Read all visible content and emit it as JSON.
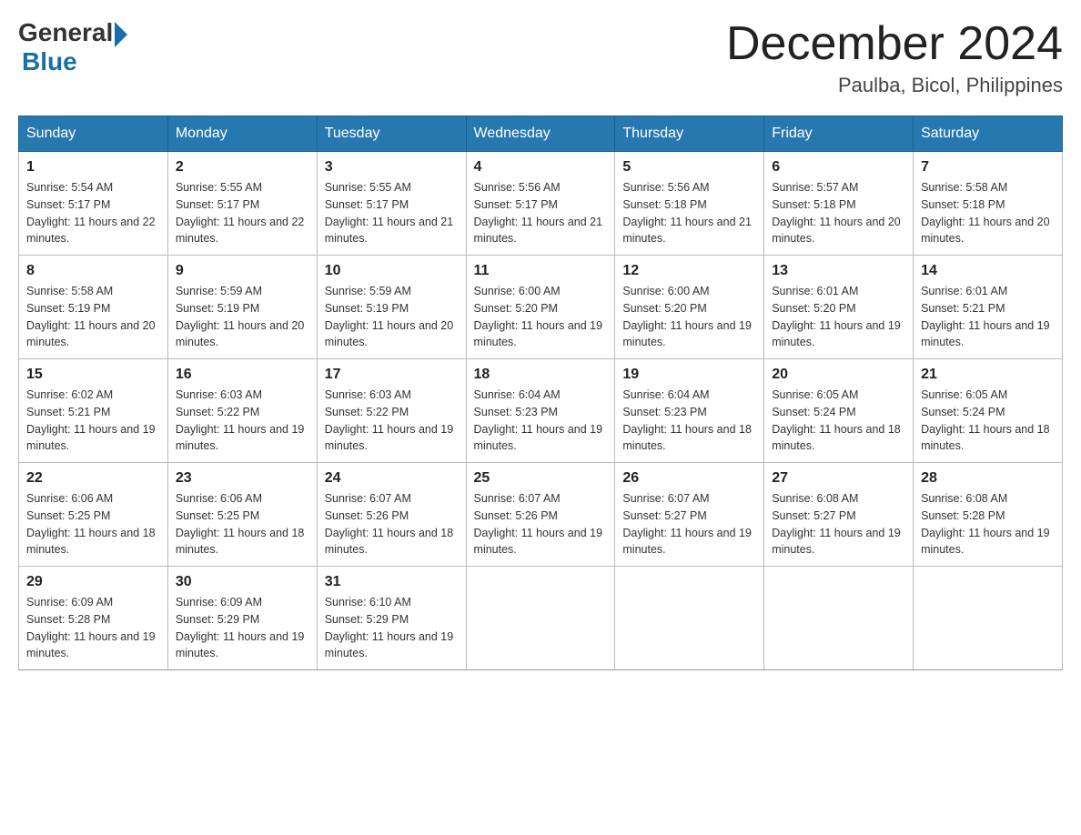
{
  "header": {
    "logo_general": "General",
    "logo_blue": "Blue",
    "month_year": "December 2024",
    "location": "Paulba, Bicol, Philippines"
  },
  "days_of_week": [
    "Sunday",
    "Monday",
    "Tuesday",
    "Wednesday",
    "Thursday",
    "Friday",
    "Saturday"
  ],
  "weeks": [
    [
      {
        "day": "1",
        "sunrise": "5:54 AM",
        "sunset": "5:17 PM",
        "daylight": "11 hours and 22 minutes."
      },
      {
        "day": "2",
        "sunrise": "5:55 AM",
        "sunset": "5:17 PM",
        "daylight": "11 hours and 22 minutes."
      },
      {
        "day": "3",
        "sunrise": "5:55 AM",
        "sunset": "5:17 PM",
        "daylight": "11 hours and 21 minutes."
      },
      {
        "day": "4",
        "sunrise": "5:56 AM",
        "sunset": "5:17 PM",
        "daylight": "11 hours and 21 minutes."
      },
      {
        "day": "5",
        "sunrise": "5:56 AM",
        "sunset": "5:18 PM",
        "daylight": "11 hours and 21 minutes."
      },
      {
        "day": "6",
        "sunrise": "5:57 AM",
        "sunset": "5:18 PM",
        "daylight": "11 hours and 20 minutes."
      },
      {
        "day": "7",
        "sunrise": "5:58 AM",
        "sunset": "5:18 PM",
        "daylight": "11 hours and 20 minutes."
      }
    ],
    [
      {
        "day": "8",
        "sunrise": "5:58 AM",
        "sunset": "5:19 PM",
        "daylight": "11 hours and 20 minutes."
      },
      {
        "day": "9",
        "sunrise": "5:59 AM",
        "sunset": "5:19 PM",
        "daylight": "11 hours and 20 minutes."
      },
      {
        "day": "10",
        "sunrise": "5:59 AM",
        "sunset": "5:19 PM",
        "daylight": "11 hours and 20 minutes."
      },
      {
        "day": "11",
        "sunrise": "6:00 AM",
        "sunset": "5:20 PM",
        "daylight": "11 hours and 19 minutes."
      },
      {
        "day": "12",
        "sunrise": "6:00 AM",
        "sunset": "5:20 PM",
        "daylight": "11 hours and 19 minutes."
      },
      {
        "day": "13",
        "sunrise": "6:01 AM",
        "sunset": "5:20 PM",
        "daylight": "11 hours and 19 minutes."
      },
      {
        "day": "14",
        "sunrise": "6:01 AM",
        "sunset": "5:21 PM",
        "daylight": "11 hours and 19 minutes."
      }
    ],
    [
      {
        "day": "15",
        "sunrise": "6:02 AM",
        "sunset": "5:21 PM",
        "daylight": "11 hours and 19 minutes."
      },
      {
        "day": "16",
        "sunrise": "6:03 AM",
        "sunset": "5:22 PM",
        "daylight": "11 hours and 19 minutes."
      },
      {
        "day": "17",
        "sunrise": "6:03 AM",
        "sunset": "5:22 PM",
        "daylight": "11 hours and 19 minutes."
      },
      {
        "day": "18",
        "sunrise": "6:04 AM",
        "sunset": "5:23 PM",
        "daylight": "11 hours and 19 minutes."
      },
      {
        "day": "19",
        "sunrise": "6:04 AM",
        "sunset": "5:23 PM",
        "daylight": "11 hours and 18 minutes."
      },
      {
        "day": "20",
        "sunrise": "6:05 AM",
        "sunset": "5:24 PM",
        "daylight": "11 hours and 18 minutes."
      },
      {
        "day": "21",
        "sunrise": "6:05 AM",
        "sunset": "5:24 PM",
        "daylight": "11 hours and 18 minutes."
      }
    ],
    [
      {
        "day": "22",
        "sunrise": "6:06 AM",
        "sunset": "5:25 PM",
        "daylight": "11 hours and 18 minutes."
      },
      {
        "day": "23",
        "sunrise": "6:06 AM",
        "sunset": "5:25 PM",
        "daylight": "11 hours and 18 minutes."
      },
      {
        "day": "24",
        "sunrise": "6:07 AM",
        "sunset": "5:26 PM",
        "daylight": "11 hours and 18 minutes."
      },
      {
        "day": "25",
        "sunrise": "6:07 AM",
        "sunset": "5:26 PM",
        "daylight": "11 hours and 19 minutes."
      },
      {
        "day": "26",
        "sunrise": "6:07 AM",
        "sunset": "5:27 PM",
        "daylight": "11 hours and 19 minutes."
      },
      {
        "day": "27",
        "sunrise": "6:08 AM",
        "sunset": "5:27 PM",
        "daylight": "11 hours and 19 minutes."
      },
      {
        "day": "28",
        "sunrise": "6:08 AM",
        "sunset": "5:28 PM",
        "daylight": "11 hours and 19 minutes."
      }
    ],
    [
      {
        "day": "29",
        "sunrise": "6:09 AM",
        "sunset": "5:28 PM",
        "daylight": "11 hours and 19 minutes."
      },
      {
        "day": "30",
        "sunrise": "6:09 AM",
        "sunset": "5:29 PM",
        "daylight": "11 hours and 19 minutes."
      },
      {
        "day": "31",
        "sunrise": "6:10 AM",
        "sunset": "5:29 PM",
        "daylight": "11 hours and 19 minutes."
      },
      null,
      null,
      null,
      null
    ]
  ],
  "labels": {
    "sunrise_prefix": "Sunrise: ",
    "sunset_prefix": "Sunset: ",
    "daylight_prefix": "Daylight: "
  }
}
